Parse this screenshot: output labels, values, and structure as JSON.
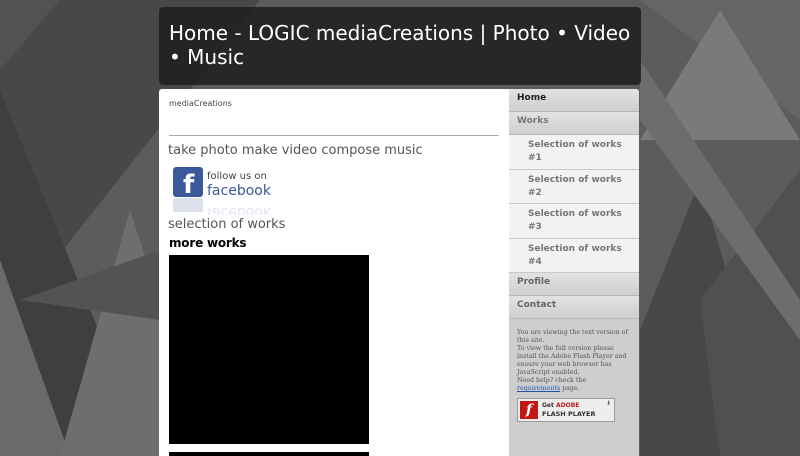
{
  "header": {
    "title": "Home - LOGIC mediaCreations | Photo • Video • Music"
  },
  "content": {
    "company": "mediaCreations",
    "tagline": "take photo make video compose music",
    "facebook_badge": {
      "line1": "follow us on",
      "line2": "facebook",
      "icon": "facebook-icon"
    },
    "section_label": "selection of works",
    "more_works": "more works"
  },
  "sidebar": {
    "nav": [
      {
        "label": "Home"
      },
      {
        "label": "Works"
      }
    ],
    "subnav": [
      {
        "label": "Selection of works #1"
      },
      {
        "label": "Selection of works #2"
      },
      {
        "label": "Selection of works #3"
      },
      {
        "label": "Selection of works #4"
      }
    ],
    "nav_after": [
      {
        "label": "Profile"
      },
      {
        "label": "Contact"
      }
    ],
    "notice": {
      "line1": "You are viewing the text version of this site.",
      "line2": "To view the full version please install the Adobe Flash Player and ensure your web browser has JavaScript enabled.",
      "line3_pre": "Need help? check the",
      "link": "requirements",
      "line3_post": "page."
    },
    "flash_badge": {
      "get": "Get",
      "adobe": "ADOBE",
      "player": "FLASH PLAYER",
      "icon": "f",
      "arrow": "⬇"
    }
  },
  "colors": {
    "header_bg": "#1e1e1e",
    "sidebar_bg": "#cecece",
    "flash_red": "#c01818",
    "facebook_blue": "#3b5998"
  }
}
